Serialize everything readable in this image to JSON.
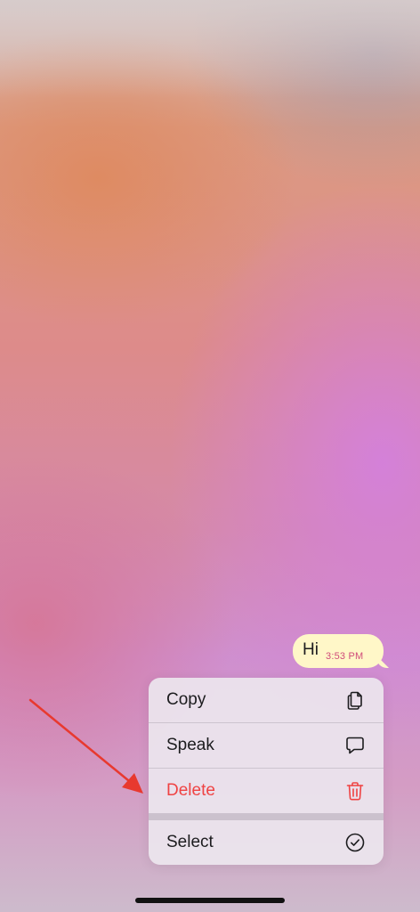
{
  "message": {
    "text": "Hi",
    "time": "3:53 PM"
  },
  "context_menu": {
    "items": [
      {
        "label": "Copy",
        "icon": "copy-icon"
      },
      {
        "label": "Speak",
        "icon": "speech-bubble-icon"
      },
      {
        "label": "Delete",
        "icon": "trash-icon",
        "destructive": true
      },
      {
        "label": "Select",
        "icon": "checkmark-circle-icon"
      }
    ]
  },
  "colors": {
    "bubble": "#fff7c8",
    "time": "#d04c7a",
    "destructive": "#ef4343",
    "annotation_arrow": "#e8392f"
  }
}
